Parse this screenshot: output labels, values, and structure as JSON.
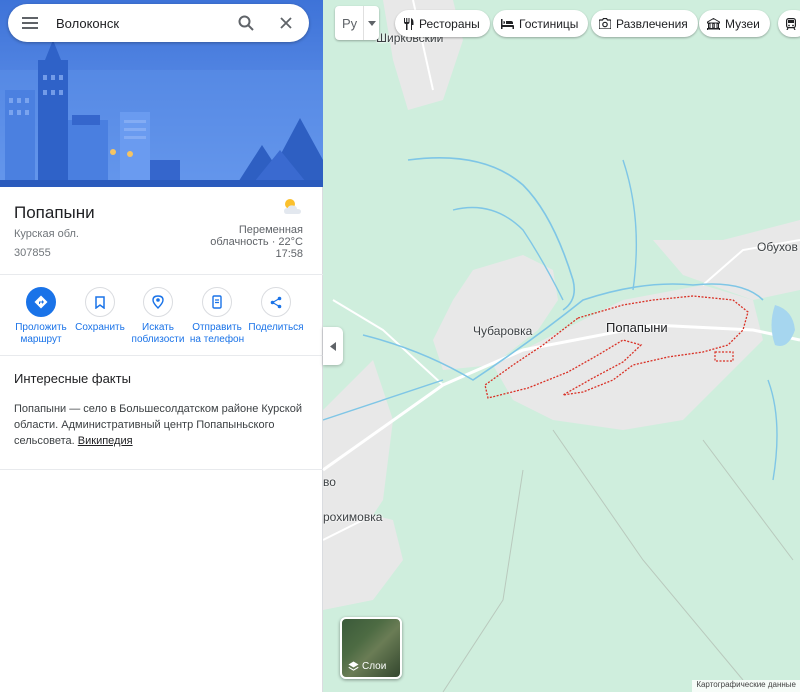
{
  "search": {
    "value": "Волоконск"
  },
  "place": {
    "title": "Попапыни",
    "region": "Курская обл.",
    "postcode": "307855",
    "weather": {
      "line1": "Переменная",
      "line2": "облачность · 22°C",
      "time": "17:58"
    }
  },
  "actions": [
    {
      "label1": "Проложить",
      "label2": "маршрут"
    },
    {
      "label1": "Сохранить",
      "label2": ""
    },
    {
      "label1": "Искать",
      "label2": "поблизости"
    },
    {
      "label1": "Отправить",
      "label2": "на телефон"
    },
    {
      "label1": "Поделиться",
      "label2": ""
    }
  ],
  "facts": {
    "heading": "Интересные факты",
    "text": "Попапыни — село в Большесолдатском районе Курской области. Административный центр Попапыньского сельсовета.",
    "link": "Википедия"
  },
  "toolbar": {
    "lang": "Ру",
    "chips": [
      "Рестораны",
      "Гостиницы",
      "Развлечения",
      "Музеи"
    ]
  },
  "map_labels": {
    "shirkovsky": "Ширковский",
    "obukhov": "Обухов",
    "chubarovka": "Чубаровка",
    "popapyni": "Попапыни",
    "vo": "во",
    "rokhimovka": "рохимовка"
  },
  "layers": {
    "label": "Слои"
  },
  "attribution": "Картографические данные",
  "colors": {
    "accent": "#1a73e8",
    "map_green": "#cfeedd",
    "map_grey": "#e8e8e8",
    "water": "#7fc6e6",
    "boundary": "#d93025"
  }
}
